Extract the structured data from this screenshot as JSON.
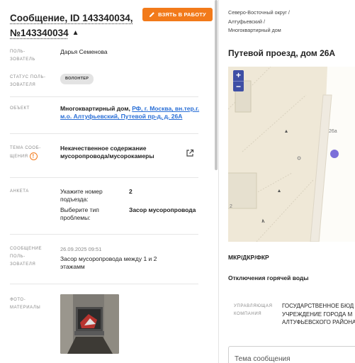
{
  "message": {
    "title_line1": "Сообщение, ID 143340034,",
    "title_line2": "№143340034",
    "take_button": "ВЗЯТЬ В РАБОТУ"
  },
  "fields": {
    "user_label": "ПОЛЬ-\nЗОВАТЕЛЬ",
    "user_value": "Дарья Семенова",
    "status_label": "СТАТУС ПОЛЬ-\nЗОВАТЕЛЯ",
    "status_value": "ВОЛОНТЕР",
    "object_label": "ОБЪЕКТ",
    "object_prefix": "Многоквартирный дом, ",
    "object_link": "РФ, г. Москва, вн.тер.г. м.о. Алтуфьевский, Путевой пр-д, д. 26А",
    "topic_label": "ТЕМА СООБ-\nЩЕНИЯ",
    "topic_value": "Некачественное содержание мусоропровода/мусорокамеры",
    "survey_label": "АНКЕТА",
    "survey_q1": "Укажите номер подъезда:",
    "survey_a1": "2",
    "survey_q2": "Выберите тип проблемы:",
    "survey_a2": "Засор мусоропровода",
    "user_msg_label": "СООБЩЕНИЕ\nПОЛЬ-\nЗОВАТЕЛЯ",
    "user_msg_time": "26.09.2025 09:51",
    "user_msg_text": "Засор мусоропровода между 1 и 2 этажамм",
    "photos_label": "ФОТО-\nМАТЕРИАЛЫ"
  },
  "right": {
    "breadcrumb1": "Северо-Восточный округ /",
    "breadcrumb2": "Алтуфьевский /",
    "breadcrumb3": "Многоквартирный дом",
    "address": "Путевой проезд, дом 26А",
    "map_house_label": "26а",
    "map_side_label": "2",
    "zoom_in": "+",
    "zoom_out": "−",
    "mkr": "МКР/ДКР/ФКР",
    "hot_water": "Отключения горячей воды",
    "mgmt_label": "УПРАВЛЯЮЩАЯ\nКОМПАНИЯ",
    "mgmt_line1": "ГОСУДАРСТВЕННОЕ БЮД",
    "mgmt_line2": "УЧРЕЖДЕНИЕ ГОРОДА М",
    "mgmt_line3": "АЛТУФЬЕВСКОГО РАЙОНА",
    "topic_placeholder": "Тема сообщения"
  },
  "colors": {
    "accent_orange": "#f27a1a",
    "link_blue": "#2a6fd6",
    "map_marker": "#7b6fd9",
    "zoom_button": "#3e4fa5"
  },
  "icons": {
    "take_button": "pencil-icon",
    "title_toggle": "chevron-up-icon",
    "topic_info": "info-icon",
    "topic_open": "external-link-icon"
  }
}
